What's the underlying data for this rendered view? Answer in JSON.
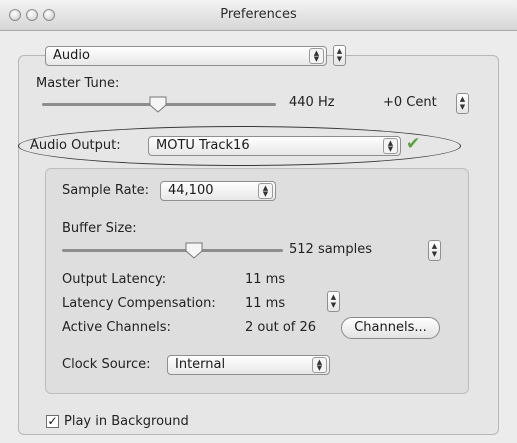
{
  "window": {
    "title": "Preferences"
  },
  "category_popup": {
    "value": "Audio"
  },
  "master_tune": {
    "label": "Master Tune:",
    "frequency": "440 Hz",
    "cent": "+0 Cent"
  },
  "audio_output": {
    "label": "Audio Output:",
    "value": "MOTU Track16"
  },
  "sample_rate": {
    "label": "Sample Rate:",
    "value": "44,100"
  },
  "buffer_size": {
    "label": "Buffer Size:",
    "value": "512 samples"
  },
  "output_latency": {
    "label": "Output Latency:",
    "value": "11 ms"
  },
  "latency_compensation": {
    "label": "Latency Compensation:",
    "value": "11 ms"
  },
  "active_channels": {
    "label": "Active Channels:",
    "value": "2 out of 26",
    "button": "Channels..."
  },
  "clock_source": {
    "label": "Clock Source:",
    "value": "Internal"
  },
  "play_in_background": {
    "label": "Play in Background",
    "checked": true
  },
  "icons": {
    "close": "circle-icon",
    "minimize": "circle-icon",
    "zoom": "circle-icon",
    "popup_arrows": "up-down-arrows-icon",
    "stepper": "stepper-icon",
    "slider_knob": "slider-knob-icon",
    "checkmark": "green-checkmark-icon"
  },
  "colors": {
    "checkmark_green": "#5aa33d"
  }
}
